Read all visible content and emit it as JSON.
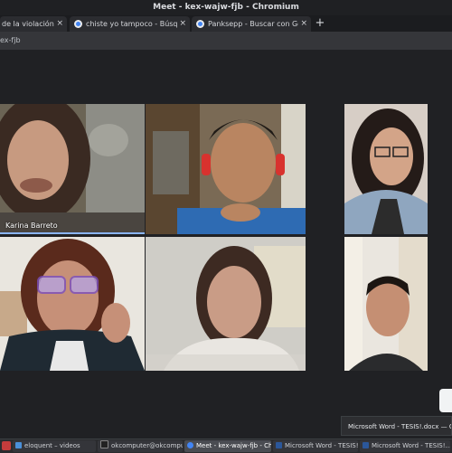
{
  "window": {
    "title": "Meet - kex-wajw-fjb - Chromium"
  },
  "tabs": [
    {
      "label": "de la violación ben",
      "close": "×"
    },
    {
      "label": "chiste yo tampoco - Búsqueda",
      "close": "×"
    },
    {
      "label": "Panksepp - Buscar con Google",
      "close": "×"
    }
  ],
  "new_tab": "+",
  "address": {
    "url": "ex-fjb"
  },
  "participants": [
    {
      "name": "Karina Barreto",
      "speaking": true
    },
    {
      "name": ""
    },
    {
      "name": ""
    },
    {
      "name": ""
    },
    {
      "name": ""
    },
    {
      "name": ""
    }
  ],
  "notification": {
    "text": "Microsoft Word - TESIS!.docx — Okula"
  },
  "taskbar": [
    {
      "label": "eloquent – videos",
      "icon_color": "#4a90d9"
    },
    {
      "label": "okcomputer@okcomput...",
      "icon_color": "#222222"
    },
    {
      "label": "Meet - kex-wajw-fjb - Ch...",
      "icon_color": "#4285f4",
      "active": true
    },
    {
      "label": "Microsoft Word - TESIS!...",
      "icon_color": "#2b579a"
    },
    {
      "label": "Microsoft Word - TESIS!...",
      "icon_color": "#2b579a"
    }
  ],
  "colors": {
    "speaking_indicator": "#8ab4f8",
    "background": "#202124"
  }
}
